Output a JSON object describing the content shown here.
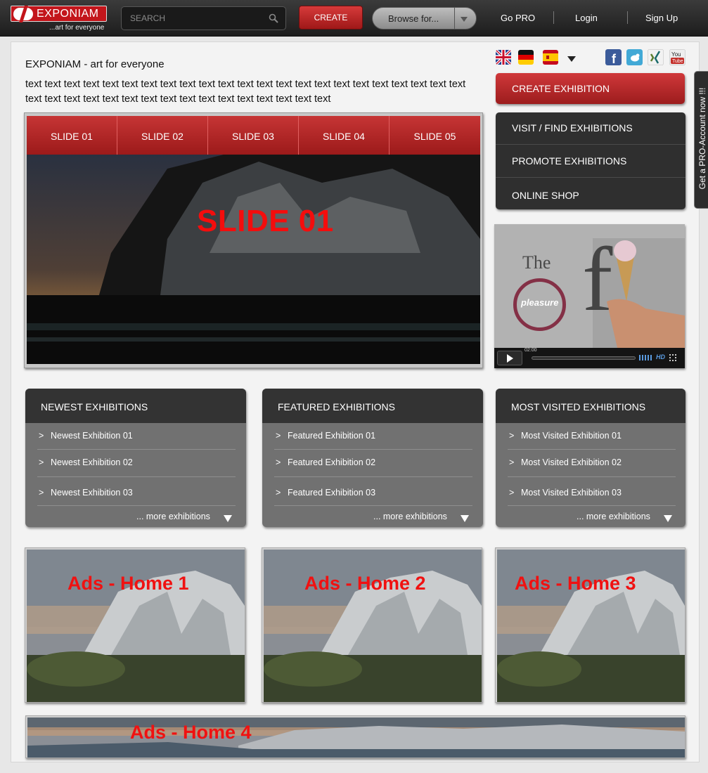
{
  "topbar": {
    "logo_text": "EXPONIAM",
    "logo_tagline": "...art for everyone",
    "search_placeholder": "SEARCH",
    "create_label": "CREATE",
    "browse_label": "Browse for...",
    "nav": [
      "Go PRO",
      "Login",
      "Sign Up"
    ]
  },
  "side_tab": "Get a PRO-Account now !!!",
  "headline": "EXPONIAM - art for everyone",
  "intro_text": "text text text text text text text text text text text text text text text text text text text text text text text text text text text text text text text text text text text text text text text",
  "languages": [
    "uk-flag-icon",
    "germany-flag-icon",
    "spain-flag-icon"
  ],
  "social": [
    "facebook-icon",
    "twitter-icon",
    "xing-icon",
    "youtube-icon"
  ],
  "slider": {
    "tabs": [
      "SLIDE 01",
      "SLIDE 02",
      "SLIDE 03",
      "SLIDE 04",
      "SLIDE 05"
    ],
    "active_title": "SLIDE 01"
  },
  "right_menu": {
    "create_exhibition": "CREATE EXHIBITION",
    "items": [
      "VISIT / FIND EXHIBITIONS",
      "PROMOTE EXHIBITIONS",
      "ONLINE SHOP"
    ]
  },
  "video": {
    "word_the": "The",
    "word_pleasure": "pleasure",
    "word_f": "f",
    "time": "02:00",
    "hd_badge": "HD"
  },
  "lists": [
    {
      "title": "NEWEST EXHIBITIONS",
      "items": [
        "Newest Exhibition 01",
        "Newest Exhibition 02",
        "Newest Exhibition 03"
      ],
      "more": "... more exhibitions"
    },
    {
      "title": "FEATURED EXHIBITIONS",
      "items": [
        "Featured Exhibition 01",
        "Featured Exhibition 02",
        "Featured Exhibition 03"
      ],
      "more": "... more exhibitions"
    },
    {
      "title": "MOST VISITED EXHIBITIONS",
      "items": [
        "Most Visited Exhibition 01",
        "Most Visited Exhibition 02",
        "Most Visited Exhibition 03"
      ],
      "more": "... more exhibitions"
    }
  ],
  "ads": [
    "Ads - Home 1",
    "Ads - Home 2",
    "Ads - Home 3",
    "Ads - Home 4"
  ],
  "chevron": ">",
  "colors": {
    "brand_red": "#c3151b",
    "dark_bar": "#2f2f2f",
    "list_body": "#717171",
    "ad_text": "#f01111"
  }
}
